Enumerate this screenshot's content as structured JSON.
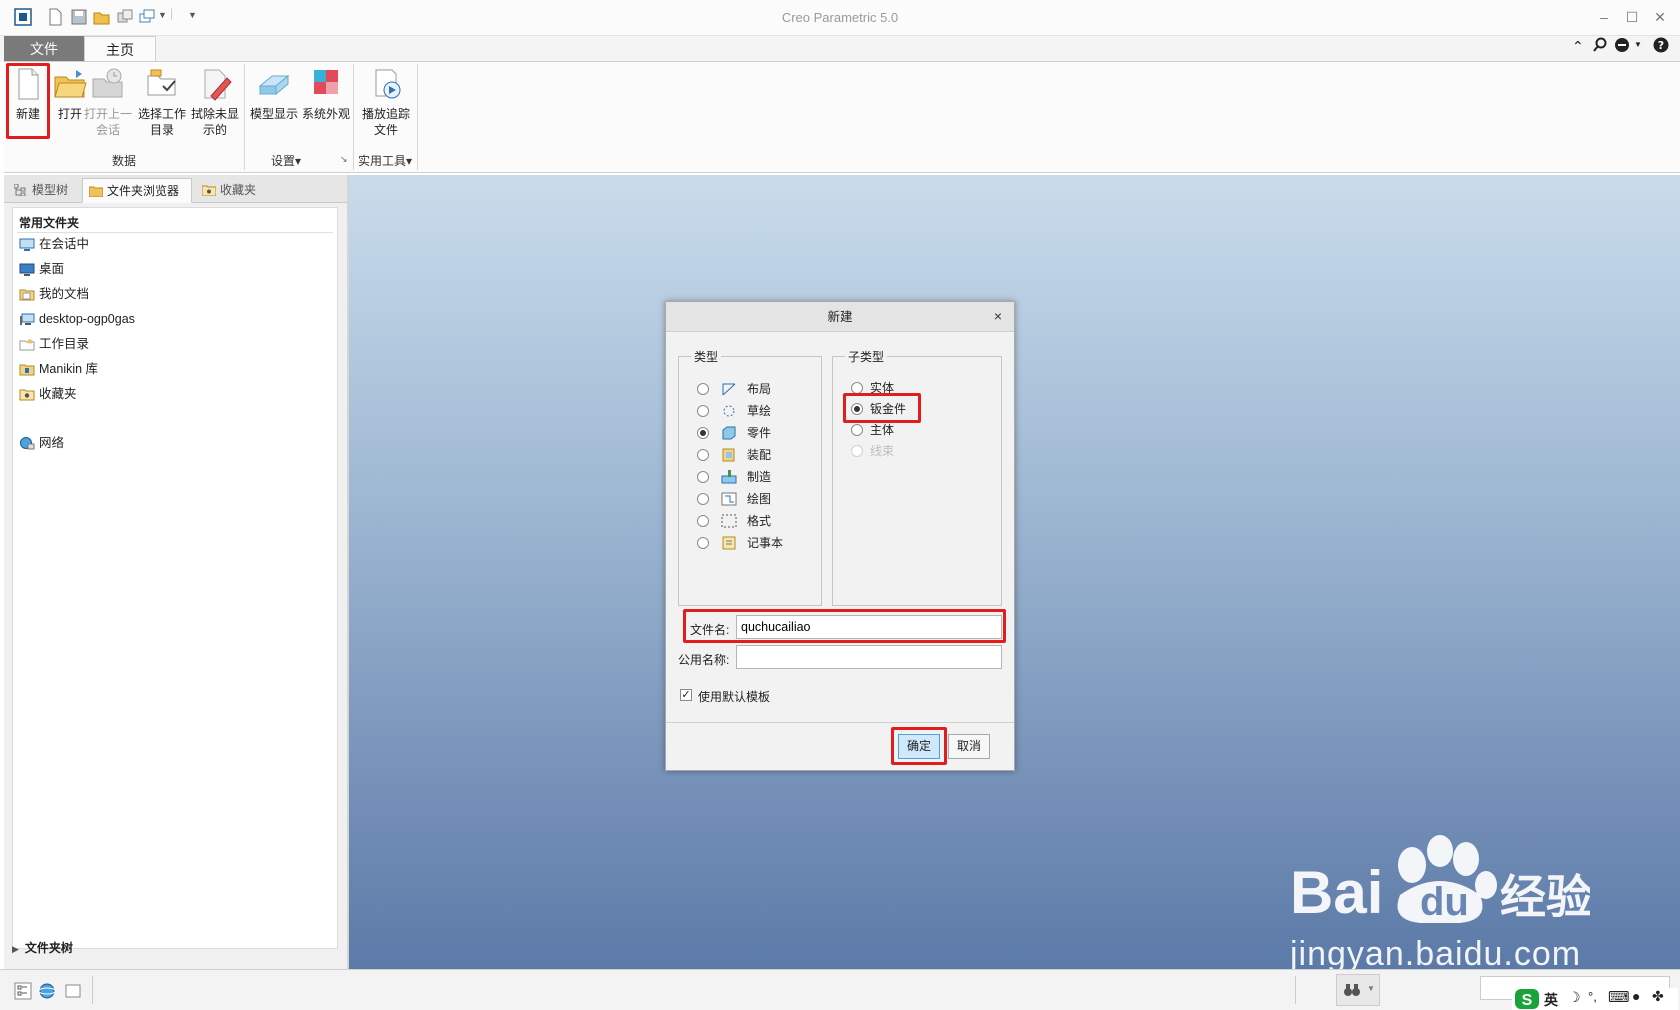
{
  "app": {
    "title": "Creo Parametric 5.0"
  },
  "tabs": [
    {
      "label": "文件"
    },
    {
      "label": "主页"
    }
  ],
  "ribbon": {
    "buttons": [
      {
        "label": "新建"
      },
      {
        "label": "打开"
      },
      {
        "label_1": "打开上一",
        "label_2": "会话"
      },
      {
        "label_1": "选择工作",
        "label_2": "目录"
      },
      {
        "label_1": "拭除未显",
        "label_2": "示的"
      },
      {
        "label": "模型显示"
      },
      {
        "label": "系统外观"
      },
      {
        "label_1": "播放追踪",
        "label_2": "文件"
      }
    ],
    "groups": [
      {
        "label": "数据"
      },
      {
        "label": "设置",
        "arrow": "▾"
      },
      {
        "label": "实用工具",
        "arrow": "▾"
      }
    ]
  },
  "navigator": {
    "tabs": [
      {
        "label": "模型树"
      },
      {
        "label": "文件夹浏览器"
      },
      {
        "label": "收藏夹"
      }
    ],
    "header": "常用文件夹",
    "items": [
      {
        "label": "在会话中",
        "icon": "session-icon"
      },
      {
        "label": "桌面",
        "icon": "desktop-icon"
      },
      {
        "label": "我的文档",
        "icon": "documents-icon"
      },
      {
        "label": "desktop-ogp0gas",
        "icon": "computer-icon"
      },
      {
        "label": "工作目录",
        "icon": "working-dir-icon"
      },
      {
        "label": "Manikin 库",
        "icon": "library-icon"
      },
      {
        "label": "收藏夹",
        "icon": "favorites-icon"
      },
      {
        "label": "网络",
        "icon": "network-icon"
      }
    ],
    "folder_tree": "文件夹树"
  },
  "dialog": {
    "title": "新建",
    "close": "×",
    "type_legend": "类型",
    "types": [
      {
        "label": "布局",
        "selected": false
      },
      {
        "label": "草绘",
        "selected": false
      },
      {
        "label": "零件",
        "selected": true
      },
      {
        "label": "装配",
        "selected": false
      },
      {
        "label": "制造",
        "selected": false
      },
      {
        "label": "绘图",
        "selected": false
      },
      {
        "label": "格式",
        "selected": false
      },
      {
        "label": "记事本",
        "selected": false
      }
    ],
    "subtype_legend": "子类型",
    "subtypes": [
      {
        "label": "实体",
        "selected": false,
        "enabled": true
      },
      {
        "label": "钣金件",
        "selected": true,
        "enabled": true
      },
      {
        "label": "主体",
        "selected": false,
        "enabled": true
      },
      {
        "label": "线束",
        "selected": false,
        "enabled": false
      }
    ],
    "filename_label": "文件名:",
    "filename_value": "quchucailiao",
    "common_name_label": "公用名称:",
    "common_name_value": "",
    "use_default_template": "使用默认模板",
    "use_default_template_checked": true,
    "ok": "确定",
    "cancel": "取消"
  },
  "status": {
    "ime_label": "英"
  },
  "watermark": {
    "text": "jingyan.baidu.com",
    "brand": "Bai",
    "brand_du": "du",
    "brand_cn": "经验"
  },
  "colors": {
    "highlight": "#e21d1d",
    "ok_button": "#cfe8fb",
    "file_tab": "#7a7a7a"
  }
}
